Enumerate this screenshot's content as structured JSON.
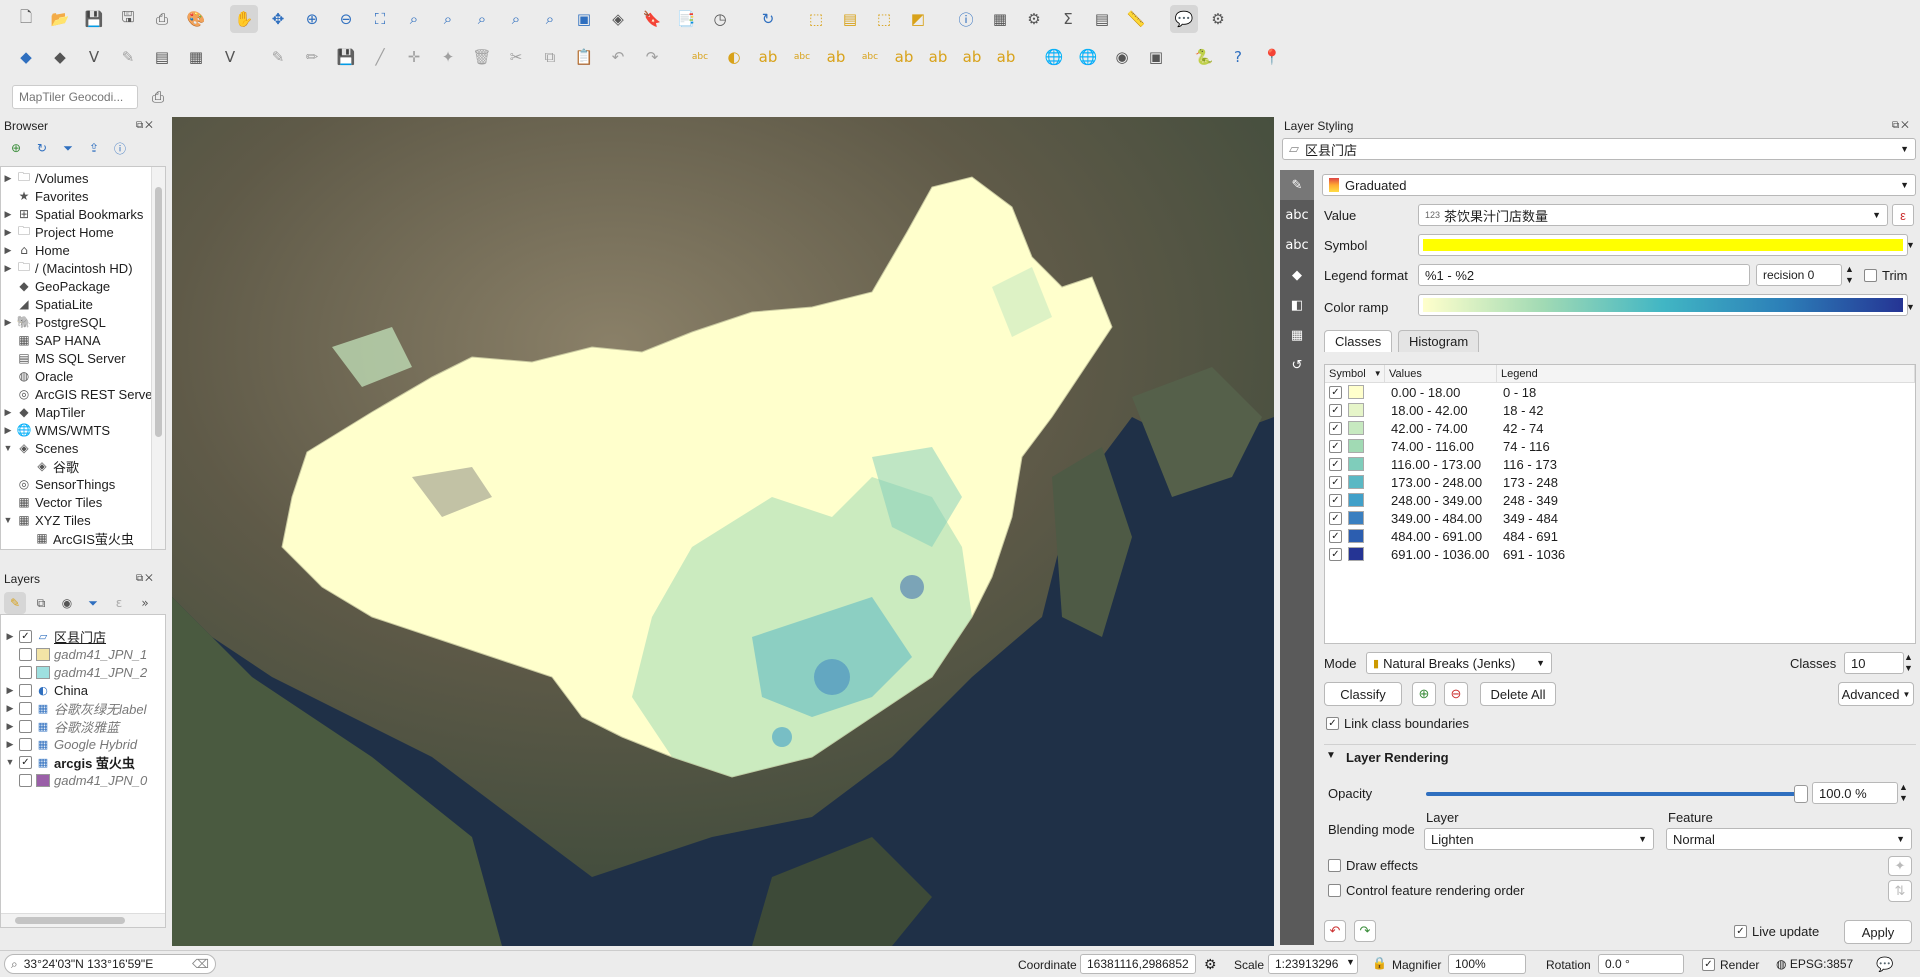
{
  "toolbar1": [
    "new-project-icon",
    "open-icon",
    "save-icon",
    "save-as-icon",
    "print-layout-icon",
    "style-manager-icon",
    "pan-icon",
    "pan-to-selection-icon",
    "zoom-in-icon",
    "zoom-out-icon",
    "zoom-full-icon",
    "zoom-to-selection-icon",
    "zoom-to-layer-icon",
    "zoom-native-icon",
    "zoom-last-icon",
    "zoom-next-icon",
    "new-map-view-icon",
    "new-3d-view-icon",
    "new-bookmark-icon",
    "show-bookmarks-icon",
    "temporal-controller-icon",
    "refresh-icon",
    "select-features-icon",
    "select-by-value-icon",
    "deselect-icon",
    "select-location-icon",
    "identify-icon",
    "attribute-table-icon",
    "processing-toolbox-icon",
    "statistics-icon",
    "field-calculator-icon",
    "measure-icon",
    "map-tips-icon",
    "no-action-icon"
  ],
  "toolbar2": [
    "data-source-manager-icon",
    "new-geopackage-icon",
    "new-shapefile-icon",
    "digitize-icon",
    "new-temporary-layer-icon",
    "new-virtual-layer-icon",
    "new-mesh-icon",
    "edits-icon",
    "toggle-editing-icon",
    "save-edits-icon",
    "add-feature-icon",
    "vertex-tool-icon",
    "modify-attributes-icon",
    "delete-icon",
    "cut-icon",
    "copy-icon",
    "paste-icon",
    "undo-icon",
    "redo-icon",
    "label-tool-icon",
    "label-highlight-icon",
    "label-pin-icon",
    "label-show-hide-icon",
    "label-move-icon",
    "label-rotate-icon",
    "label-change-icon",
    "label-pin-diagram-icon",
    "label-show-diagram-icon",
    "label-move-diagram-icon",
    "globe-icon",
    "globe-grid-icon",
    "robot-icon",
    "gear-plugin-icon",
    "python-icon",
    "help-icon",
    "location-pin-icon"
  ],
  "geocoder": {
    "placeholder": "MapTiler Geocodi..."
  },
  "browser": {
    "title": "Browser",
    "items": [
      {
        "label": "/Volumes",
        "icon": "folder-icon",
        "arrow": "▶"
      },
      {
        "label": "Favorites",
        "icon": "star-icon",
        "arrow": ""
      },
      {
        "label": "Spatial Bookmarks",
        "icon": "bookmark-icon",
        "arrow": "▶"
      },
      {
        "label": "Project Home",
        "icon": "folder-icon",
        "arrow": "▶"
      },
      {
        "label": "Home",
        "icon": "home-icon",
        "arrow": "▶"
      },
      {
        "label": "/ (Macintosh HD)",
        "icon": "folder-icon",
        "arrow": "▶"
      },
      {
        "label": "GeoPackage",
        "icon": "geopackage-icon",
        "arrow": ""
      },
      {
        "label": "SpatiaLite",
        "icon": "spatialite-icon",
        "arrow": ""
      },
      {
        "label": "PostgreSQL",
        "icon": "postgresql-icon",
        "arrow": "▶"
      },
      {
        "label": "SAP HANA",
        "icon": "sap-hana-icon",
        "arrow": ""
      },
      {
        "label": "MS SQL Server",
        "icon": "mssql-icon",
        "arrow": ""
      },
      {
        "label": "Oracle",
        "icon": "oracle-icon",
        "arrow": ""
      },
      {
        "label": "ArcGIS REST Server",
        "icon": "arcgis-icon",
        "arrow": ""
      },
      {
        "label": "MapTiler",
        "icon": "maptiler-icon",
        "arrow": "▶"
      },
      {
        "label": "WMS/WMTS",
        "icon": "wms-icon",
        "arrow": "▶"
      },
      {
        "label": "Scenes",
        "icon": "scenes-icon",
        "arrow": "▼"
      },
      {
        "label": "谷歌",
        "icon": "scene-item-icon",
        "arrow": "",
        "indent": true
      },
      {
        "label": "SensorThings",
        "icon": "sensorthings-icon",
        "arrow": ""
      },
      {
        "label": "Vector Tiles",
        "icon": "vector-tiles-icon",
        "arrow": ""
      },
      {
        "label": "XYZ Tiles",
        "icon": "xyz-tiles-icon",
        "arrow": "▼"
      },
      {
        "label": "ArcGIS萤火虫",
        "icon": "xyz-item-icon",
        "arrow": "",
        "indent": true
      }
    ]
  },
  "layers": {
    "title": "Layers",
    "items": [
      {
        "label": "区县门店",
        "checked": true,
        "arrow": "▶",
        "sw": "polygon-icon",
        "style": "u",
        "color": "#ffffff"
      },
      {
        "label": "gadm41_JPN_1",
        "checked": false,
        "arrow": "",
        "sw": "fill",
        "style": "ital",
        "color": "#f3e4a6"
      },
      {
        "label": "gadm41_JPN_2",
        "checked": false,
        "arrow": "",
        "sw": "fill",
        "style": "ital",
        "color": "#9ee0e0"
      },
      {
        "label": "China",
        "checked": false,
        "arrow": "▶",
        "sw": "group-icon",
        "style": "",
        "color": "#ffffff"
      },
      {
        "label": "谷歌灰绿无label",
        "checked": false,
        "arrow": "▶",
        "sw": "raster-icon",
        "style": "ital",
        "color": "#ffffff"
      },
      {
        "label": "谷歌淡雅蓝",
        "checked": false,
        "arrow": "▶",
        "sw": "raster-icon",
        "style": "ital",
        "color": "#ffffff"
      },
      {
        "label": "Google Hybrid",
        "checked": false,
        "arrow": "▶",
        "sw": "raster-icon",
        "style": "ital",
        "color": "#ffffff"
      },
      {
        "label": "arcgis 萤火虫",
        "checked": true,
        "arrow": "▼",
        "sw": "raster-icon",
        "style": "bold",
        "color": "#ffffff"
      },
      {
        "label": "gadm41_JPN_0",
        "checked": false,
        "arrow": "",
        "sw": "fill",
        "style": "ital",
        "color": "#9a5fa8"
      }
    ]
  },
  "styling": {
    "title": "Layer Styling",
    "layer_name": "区县门店",
    "renderer": "Graduated",
    "value_label": "Value",
    "value": "茶饮果汁门店数量",
    "value_prefix": "123",
    "symbol_label": "Symbol",
    "legend_format_label": "Legend format",
    "legend_format": "%1 - %2",
    "precision": "recision 0",
    "trim_label": "Trim",
    "color_ramp_label": "Color ramp",
    "tab_classes": "Classes",
    "tab_histogram": "Histogram",
    "col_symbol": "Symbol",
    "col_values": "Values",
    "col_legend": "Legend",
    "classes": [
      {
        "values": "0.00 - 18.00",
        "legend": "0 - 18",
        "color": "#ffffcc"
      },
      {
        "values": "18.00 - 42.00",
        "legend": "18 - 42",
        "color": "#e6f5c9"
      },
      {
        "values": "42.00 - 74.00",
        "legend": "42 - 74",
        "color": "#c7e9c0"
      },
      {
        "values": "74.00 - 116.00",
        "legend": "74 - 116",
        "color": "#a1dab4"
      },
      {
        "values": "116.00 - 173.00",
        "legend": "116 - 173",
        "color": "#7fcdbb"
      },
      {
        "values": "173.00 - 248.00",
        "legend": "173 - 248",
        "color": "#5ab8c4"
      },
      {
        "values": "248.00 - 349.00",
        "legend": "248 - 349",
        "color": "#41a0c9"
      },
      {
        "values": "349.00 - 484.00",
        "legend": "349 - 484",
        "color": "#3a7fc0"
      },
      {
        "values": "484.00 - 691.00",
        "legend": "484 - 691",
        "color": "#2c5eb0"
      },
      {
        "values": "691.00 - 1036.00",
        "legend": "691 - 1036",
        "color": "#253494"
      }
    ],
    "mode_label": "Mode",
    "mode": "Natural Breaks (Jenks)",
    "classes_label": "Classes",
    "classes_count": "10",
    "classify": "Classify",
    "delete_all": "Delete All",
    "advanced": "Advanced",
    "link_boundaries": "Link class boundaries",
    "layer_rendering": "Layer Rendering",
    "opacity_label": "Opacity",
    "opacity": "100.0 %",
    "blending_label": "Blending mode",
    "layer_sub": "Layer",
    "feature_sub": "Feature",
    "layer_blend": "Lighten",
    "feature_blend": "Normal",
    "draw_effects": "Draw effects",
    "control_order": "Control feature rendering order",
    "live_update": "Live update",
    "apply": "Apply"
  },
  "status": {
    "locator": "33°24'03\"N 133°16'59\"E",
    "coord_label": "Coordinate",
    "coord": "16381116,2986852",
    "scale_label": "Scale",
    "scale": "1:23913296",
    "magnifier_label": "Magnifier",
    "magnifier": "100%",
    "rotation_label": "Rotation",
    "rotation": "0.0 °",
    "render_label": "Render",
    "crs": "EPSG:3857"
  },
  "colors": {
    "accent": "#2f6fbf",
    "map_land": "#ffffcc",
    "map_sea": "#1c2a3a"
  }
}
